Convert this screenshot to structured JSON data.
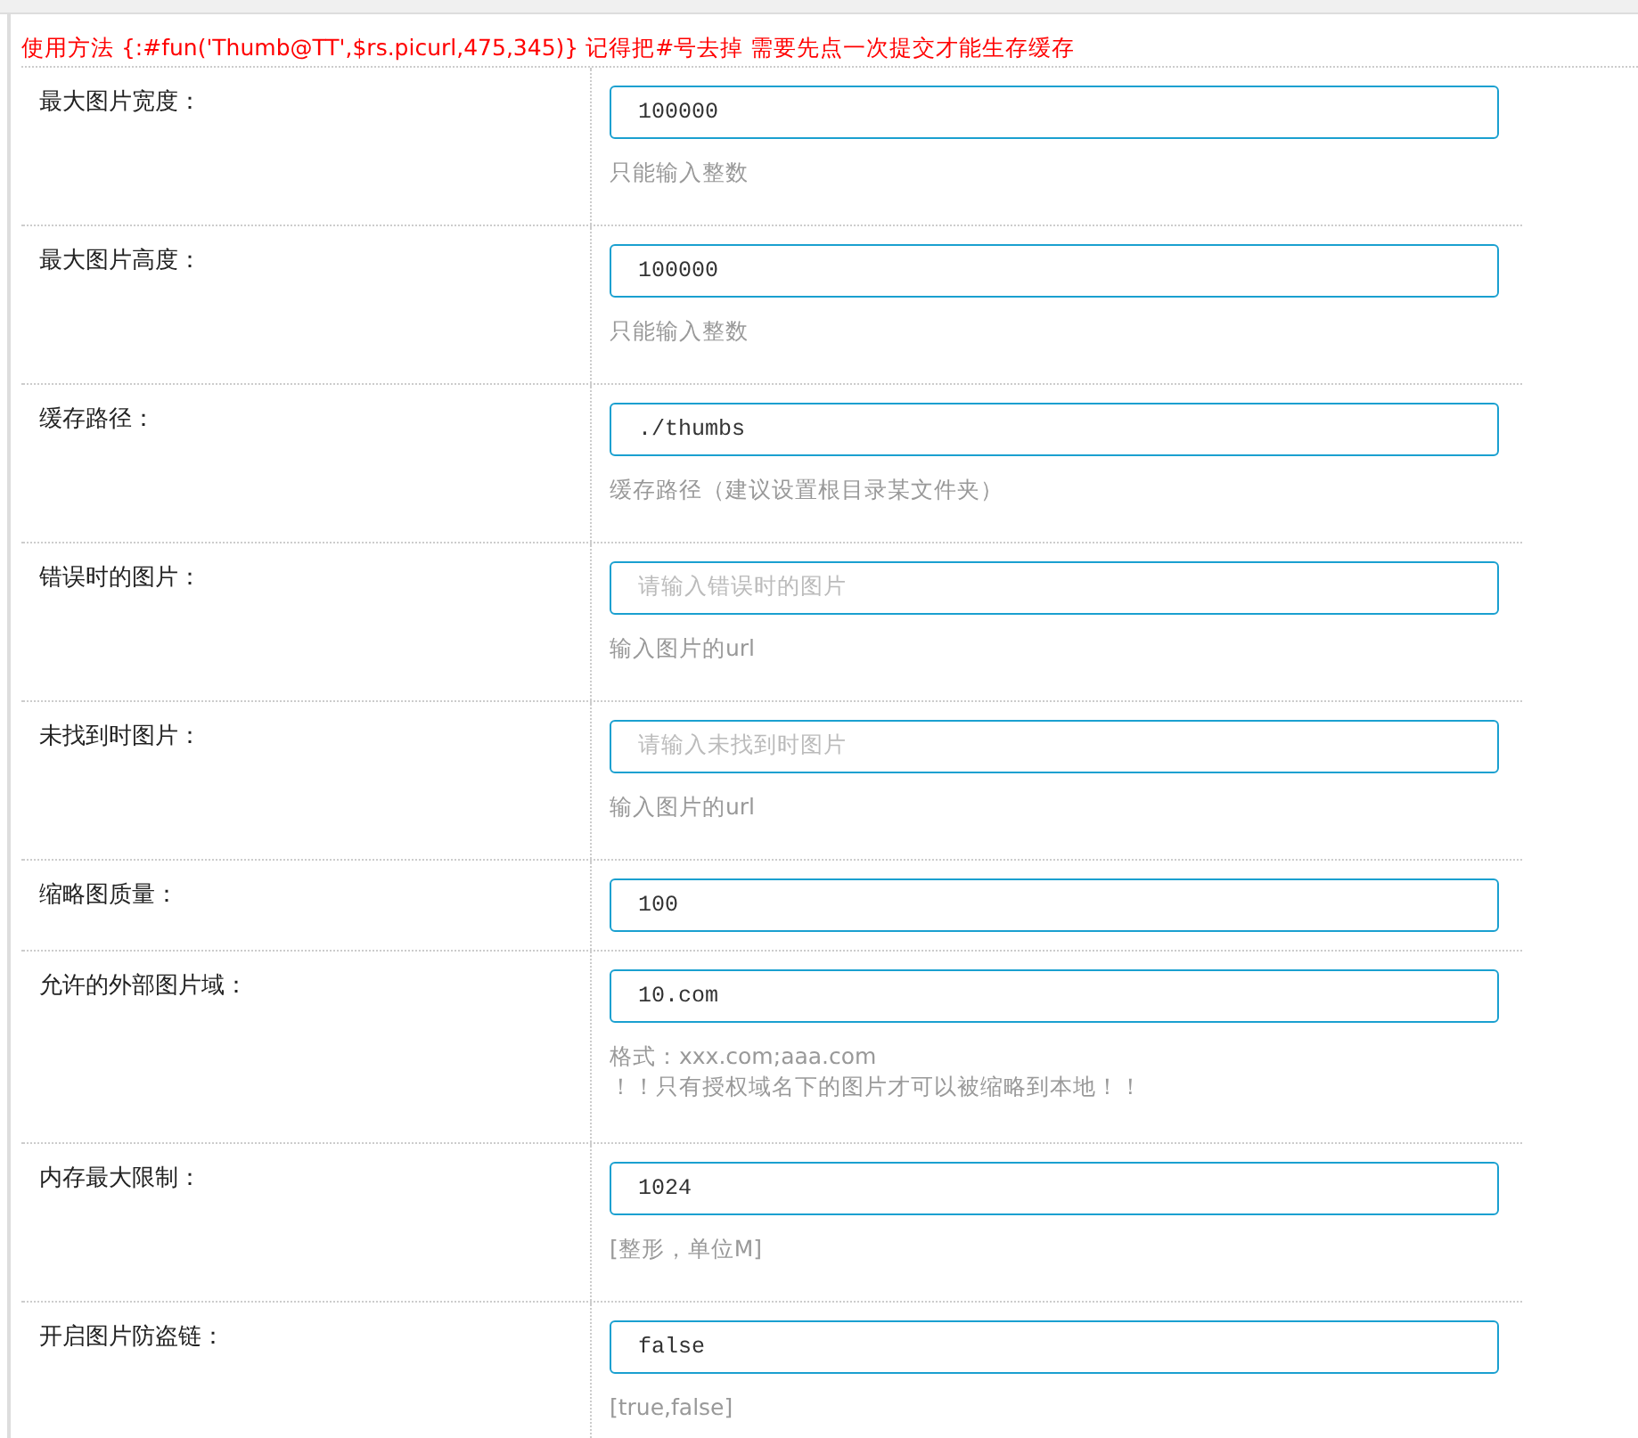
{
  "notice": "使用方法 {:#fun('Thumb@TT',$rs.picurl,475,345)} 记得把#号去掉 需要先点一次提交才能生存缓存",
  "fields": [
    {
      "label": "最大图片宽度：",
      "value": "100000",
      "hints": [
        "只能输入整数"
      ]
    },
    {
      "label": "最大图片高度：",
      "value": "100000",
      "hints": [
        "只能输入整数"
      ]
    },
    {
      "label": "缓存路径：",
      "value": "./thumbs",
      "hints": [
        "缓存路径（建议设置根目录某文件夹）"
      ]
    },
    {
      "label": "错误时的图片：",
      "placeholder": "请输入错误时的图片",
      "hints": [
        "输入图片的url"
      ]
    },
    {
      "label": "未找到时图片：",
      "placeholder": "请输入未找到时图片",
      "hints": [
        "输入图片的url"
      ]
    },
    {
      "label": "缩略图质量：",
      "value": "100"
    },
    {
      "label": "允许的外部图片域：",
      "value": "10.com",
      "hints": [
        "格式：xxx.com;aaa.com",
        "！！只有授权域名下的图片才可以被缩略到本地！！"
      ]
    },
    {
      "label": "内存最大限制：",
      "value": "1024",
      "hints": [
        "[整形，单位M]"
      ]
    },
    {
      "label": "开启图片防盗链：",
      "value": "false",
      "hints": [
        "[true,false]"
      ]
    }
  ]
}
